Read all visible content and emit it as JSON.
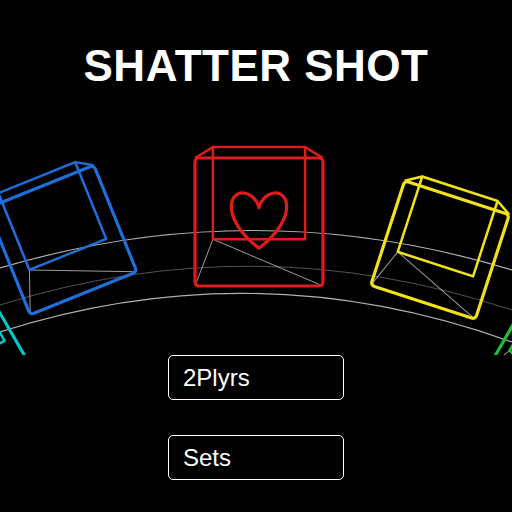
{
  "title": "SHATTER SHOT",
  "characters": [
    {
      "color": "#00c8c8",
      "selected": false
    },
    {
      "color": "#1e6fd9",
      "selected": false
    },
    {
      "color": "#e01b1b",
      "selected": true
    },
    {
      "color": "#f2e21a",
      "selected": false
    },
    {
      "color": "#1fbf3a",
      "selected": false
    }
  ],
  "menu": [
    {
      "label": "2Plyrs"
    },
    {
      "label": "Sets"
    }
  ]
}
